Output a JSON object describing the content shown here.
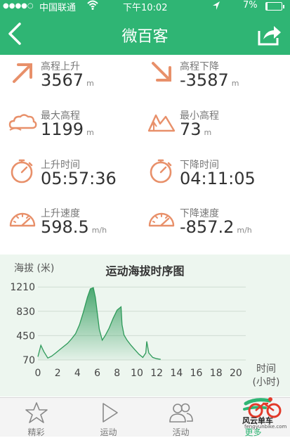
{
  "status_bar": {
    "signal": "●●●●○",
    "carrier": "中国联通",
    "time": "下午10:02",
    "battery_text": "7%"
  },
  "nav": {
    "title": "微百客"
  },
  "stats": [
    {
      "label": "高程上升",
      "value": "3567",
      "unit": "m",
      "icon": "ascent-arrow-icon"
    },
    {
      "label": "高程下降",
      "value": "-3587",
      "unit": "m",
      "icon": "descent-arrow-icon"
    },
    {
      "label": "最大高程",
      "value": "1199",
      "unit": "m",
      "icon": "cloud-icon"
    },
    {
      "label": "最小高程",
      "value": "73",
      "unit": "m",
      "icon": "mountain-icon"
    },
    {
      "label": "上升时间",
      "value": "05:57:36",
      "unit": "",
      "icon": "stopwatch-icon"
    },
    {
      "label": "下降时间",
      "value": "04:11:05",
      "unit": "",
      "icon": "stopwatch-icon"
    },
    {
      "label": "上升速度",
      "value": "598.5",
      "unit": "m/h",
      "icon": "speedometer-icon"
    },
    {
      "label": "下降速度",
      "value": "-857.2",
      "unit": "m/h",
      "icon": "speedometer-icon"
    }
  ],
  "chart_data": {
    "type": "area",
    "title": "运动海拔时序图",
    "ylabel": "海拔 (米)",
    "xlabel": "时间\n(小时)",
    "xlabel_lines": [
      "时间",
      "(小时)"
    ],
    "x_ticks": [
      0,
      2,
      4,
      6,
      8,
      10,
      12,
      14,
      16,
      18,
      20
    ],
    "y_ticks": [
      70,
      450,
      830,
      1210
    ],
    "xlim": [
      0,
      21
    ],
    "ylim": [
      70,
      1300
    ],
    "grid": "horizontal",
    "color": "#2e9a5a",
    "x": [
      0,
      0.3,
      0.6,
      1.0,
      1.4,
      1.8,
      2.2,
      2.6,
      3.0,
      3.4,
      3.8,
      4.2,
      4.6,
      5.0,
      5.3,
      5.6,
      5.8,
      6.0,
      6.2,
      6.5,
      6.8,
      7.2,
      7.6,
      8.0,
      8.4,
      8.5,
      8.7,
      9.0,
      9.4,
      9.8,
      10.2,
      10.6,
      10.9,
      11.0,
      11.2,
      11.6,
      12.0,
      12.4
    ],
    "y": [
      120,
      300,
      200,
      100,
      130,
      180,
      230,
      280,
      330,
      400,
      480,
      620,
      820,
      1050,
      1180,
      1199,
      1050,
      800,
      550,
      380,
      450,
      570,
      720,
      850,
      900,
      620,
      460,
      380,
      300,
      230,
      160,
      110,
      180,
      360,
      180,
      110,
      90,
      80
    ]
  },
  "tabs": [
    {
      "label": "精彩",
      "icon": "star-icon",
      "active": false
    },
    {
      "label": "运动",
      "icon": "play-icon",
      "active": false
    },
    {
      "label": "活动",
      "icon": "people-icon",
      "active": false
    },
    {
      "label": "更多",
      "icon": "more-icon",
      "active": true
    }
  ],
  "brand": {
    "name": "风云单车",
    "url": "fengyunbike.com"
  }
}
